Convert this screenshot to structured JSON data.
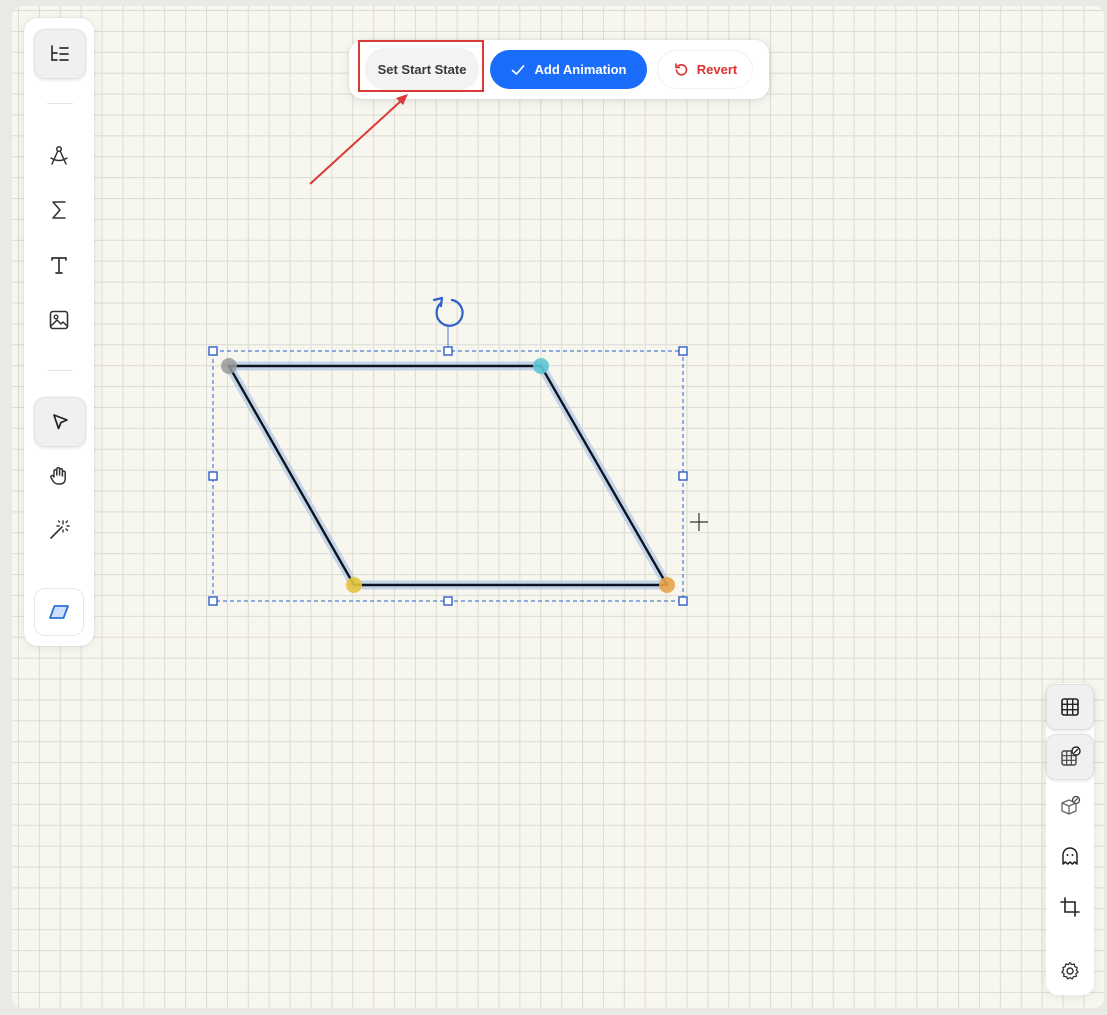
{
  "toolbar": {
    "set_start_state_label": "Set Start State",
    "add_animation_label": "Add Animation",
    "revert_label": "Revert"
  },
  "left_tools": [
    {
      "name": "outline-toggle-icon",
      "active": true
    },
    {
      "name": "geometry-compass-icon",
      "active": false
    },
    {
      "name": "sigma-formula-icon",
      "active": false
    },
    {
      "name": "text-tool-icon",
      "active": false
    },
    {
      "name": "image-tool-icon",
      "active": false
    },
    {
      "name": "select-pointer-icon",
      "active": true
    },
    {
      "name": "hand-pan-icon",
      "active": false
    },
    {
      "name": "magic-wand-icon",
      "active": false
    },
    {
      "name": "parallelogram-shape-icon",
      "active": false
    }
  ],
  "right_tools": [
    {
      "name": "grid-icon",
      "active": true
    },
    {
      "name": "snap-to-grid-icon",
      "active": true
    },
    {
      "name": "snap-to-object-icon",
      "active": false
    },
    {
      "name": "ghost-icon",
      "active": false
    },
    {
      "name": "crop-icon",
      "active": false
    },
    {
      "name": "settings-gear-icon",
      "active": false
    }
  ],
  "shape": {
    "type": "parallelogram",
    "vertex_colors": [
      "#9a9a9a",
      "#5fc6d6",
      "#e8a44a",
      "#e4c43e"
    ],
    "stroke_color": "#0e1420",
    "selection_color": "#2f5fc9"
  },
  "colors": {
    "accent": "#1a6dfa",
    "revert": "#d9322e",
    "highlight": "#d93a35"
  }
}
